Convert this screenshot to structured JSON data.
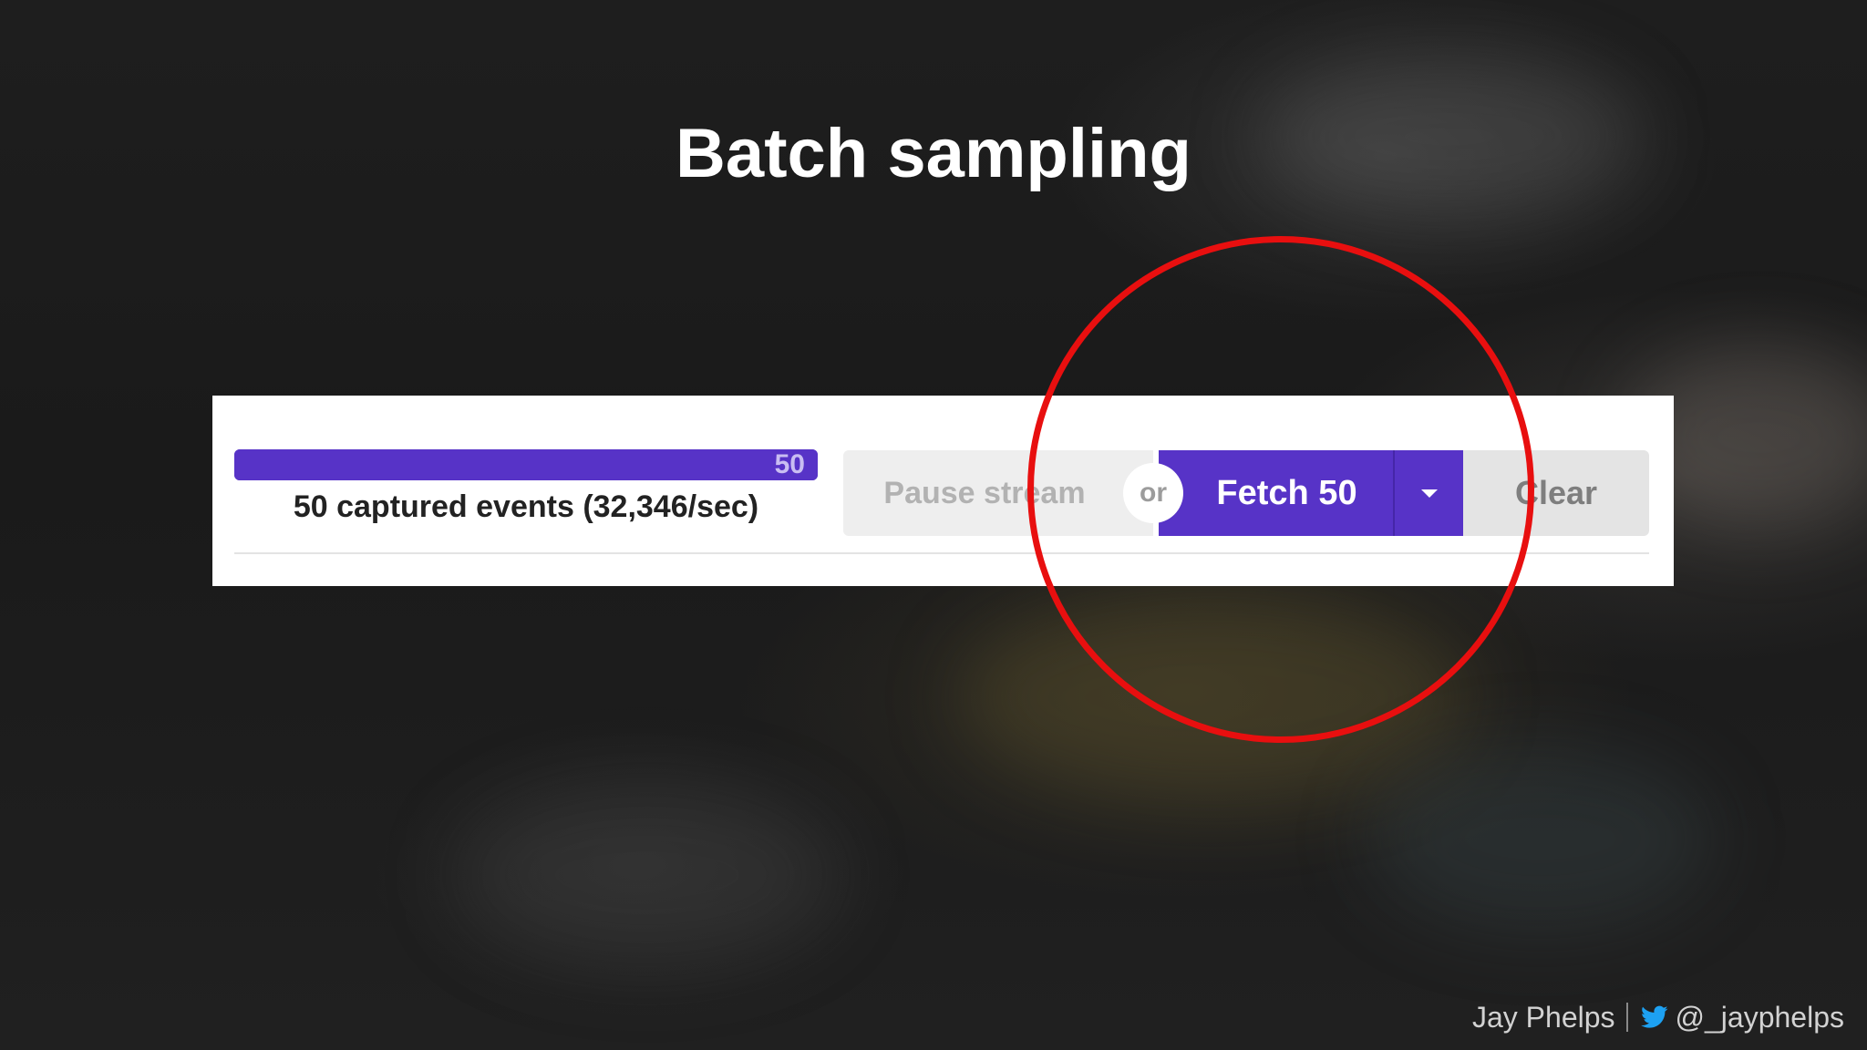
{
  "slide": {
    "title": "Batch sampling"
  },
  "capture": {
    "count_badge": "50",
    "progress": 1.0,
    "events_label": "50 captured events (32,346/sec)"
  },
  "controls": {
    "pause_label": "Pause stream",
    "or_label": "or",
    "fetch_label": "Fetch 50",
    "clear_label": "Clear"
  },
  "footer": {
    "author": "Jay Phelps",
    "handle": "@_jayphelps"
  },
  "icons": {
    "dropdown": "chevron-down-icon",
    "twitter": "twitter-bird-icon"
  },
  "colors": {
    "accent": "#5733c7",
    "highlight": "#e80f0f",
    "background": "#1c1c1c",
    "twitter": "#1da1f2"
  }
}
